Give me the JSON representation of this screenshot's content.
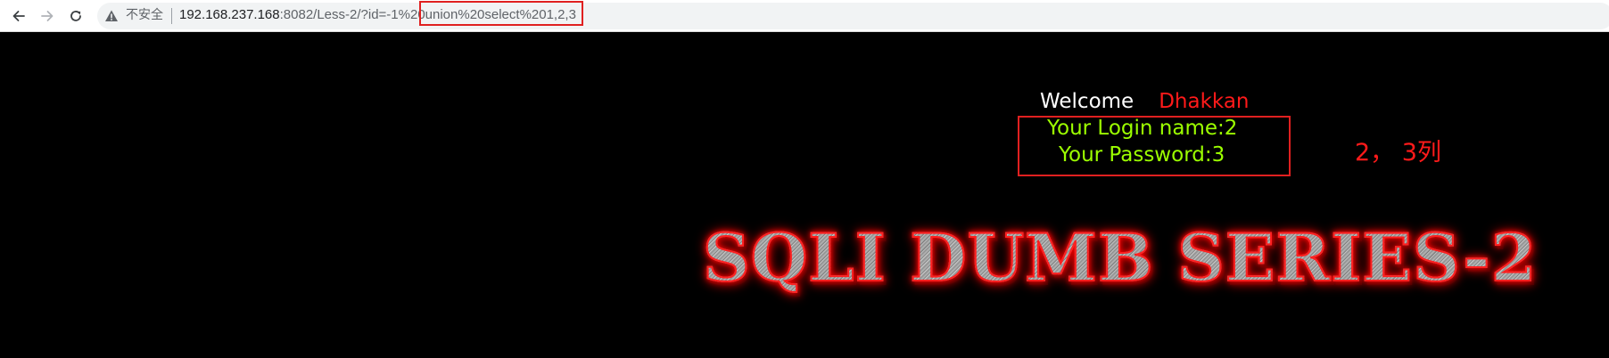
{
  "browser": {
    "back_icon": "arrow-left-icon",
    "forward_icon": "arrow-right-icon",
    "reload_icon": "reload-icon",
    "security_icon": "warning-triangle-icon",
    "security_label": "不安全",
    "url": {
      "host": "192.168.237.168",
      "rest_plain": ":8082/Less-2/?id=-1%2",
      "rest_boxed": "0union%20select%201,2,3"
    }
  },
  "page": {
    "welcome_word": "Welcome",
    "welcome_name": "Dhakkan",
    "login_line": "Your Login name:2",
    "password_line": "Your Password:3",
    "annotation": "2， 3列",
    "banner": "SQLI DUMB SERIES-2"
  },
  "colors": {
    "background": "#000000",
    "result_text": "#9cff00",
    "name_text": "#ff1a1a",
    "highlight_box": "#e02020"
  }
}
